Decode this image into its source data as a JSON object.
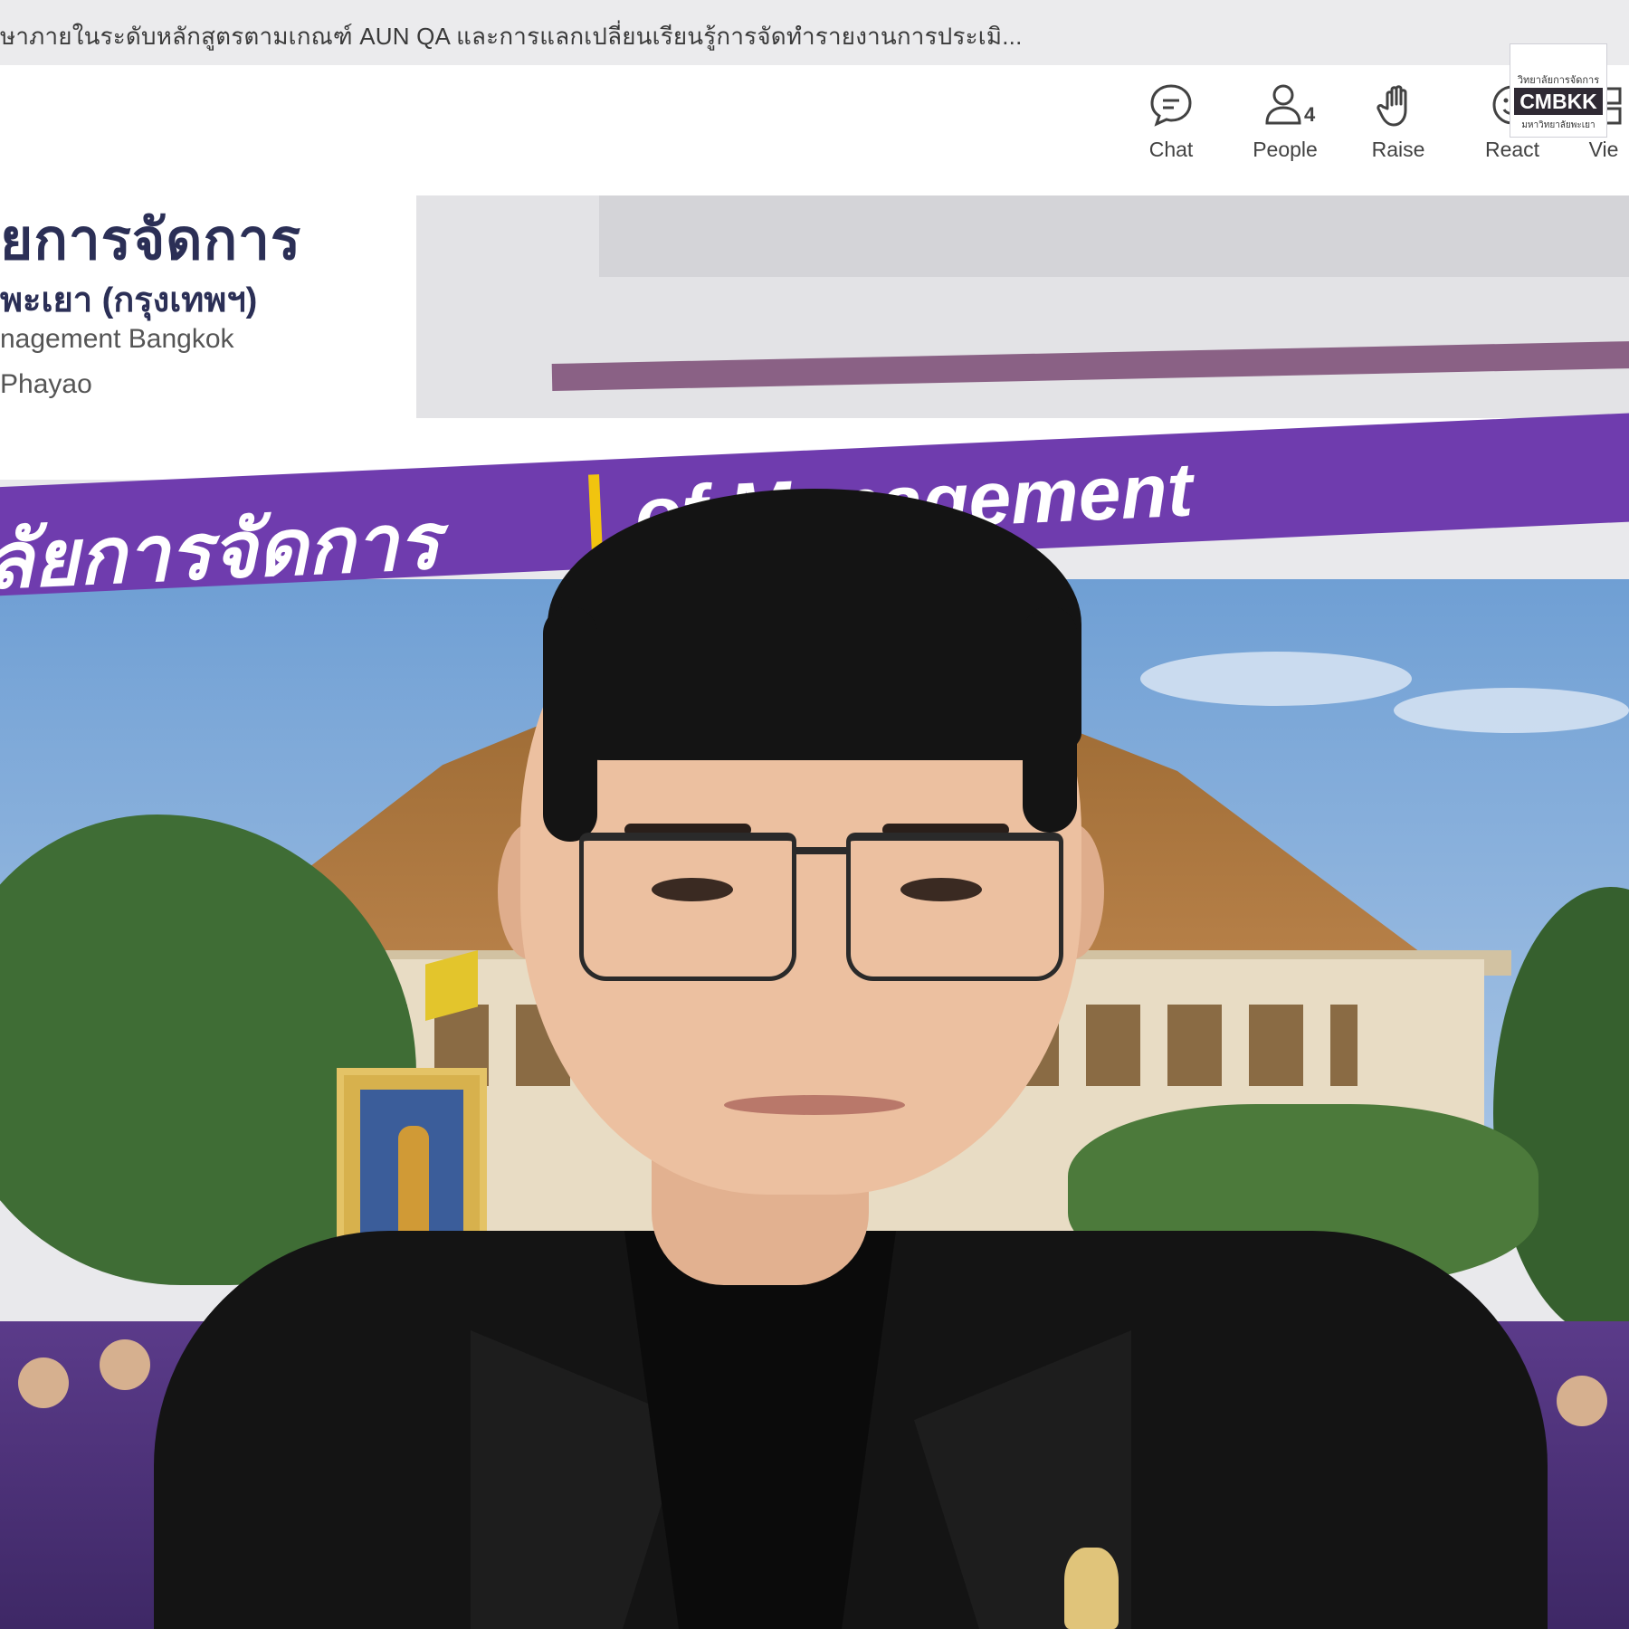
{
  "meeting": {
    "title": "ษาภายในระดับหลักสูตรตามเกณฑ์ AUN QA และการแลกเปลี่ยนเรียนรู้การจัดทำรายงานการประเมิ..."
  },
  "controls": [
    {
      "label": "Chat",
      "icon": "chat-icon"
    },
    {
      "label": "People",
      "icon": "people-icon",
      "count": "4"
    },
    {
      "label": "Raise",
      "icon": "raise-hand-icon"
    },
    {
      "label": "React",
      "icon": "react-icon"
    },
    {
      "label": "Vie",
      "icon": "view-icon"
    }
  ],
  "watermark": {
    "top": "วิทยาลัยการจัดการ",
    "main": "CMBKK",
    "bottom": "มหาวิทยาลัยพะเยา"
  },
  "slide": {
    "thai_name_line1": "ยการจัดการ",
    "thai_name_line2": "พะเยา (กรุงเทพฯ)",
    "en_name_line1": "nagement Bangkok",
    "en_name_line2": "Phayao",
    "banner_thai": "ลัยการจัดการ",
    "banner_en": "of Management"
  },
  "colors": {
    "banner": "#6f3cae",
    "banner_divider": "#f1c40f",
    "header_text": "#2b2f56",
    "mauve_line": "#8a6185"
  }
}
